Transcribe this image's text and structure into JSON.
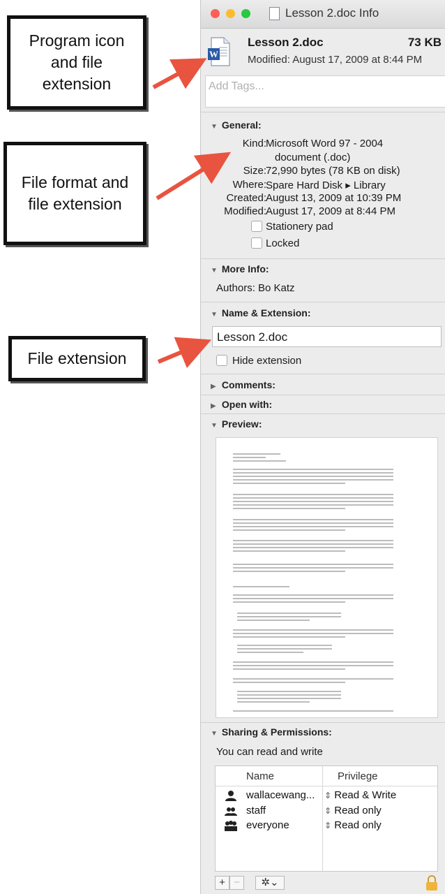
{
  "callouts": {
    "program_icon": "Program icon and file extension",
    "file_format": "File format and file extension",
    "file_extension": "File extension"
  },
  "window": {
    "title": "Lesson 2.doc Info",
    "traffic_lights": {
      "close": "#fc5f57",
      "minimize": "#fdbc2e",
      "zoom": "#28c840"
    }
  },
  "header": {
    "file_name": "Lesson 2.doc",
    "file_size": "73 KB",
    "modified": "Modified: August 17, 2009 at 8:44 PM"
  },
  "tags": {
    "placeholder": "Add Tags..."
  },
  "general": {
    "heading": "General:",
    "kind_label": "Kind:",
    "kind_value_1": "Microsoft Word 97 - 2004",
    "kind_value_2": "document (.doc)",
    "size_label": "Size:",
    "size_value": "72,990 bytes (78 KB on disk)",
    "where_label": "Where:",
    "where_value": "Spare Hard Disk ▸ Library",
    "created_label": "Created:",
    "created_value": "August 13, 2009 at 10:39 PM",
    "modified_label": "Modified:",
    "modified_value": "August 17, 2009 at 8:44 PM",
    "stationery": "Stationery pad",
    "locked": "Locked"
  },
  "more_info": {
    "heading": "More Info:",
    "authors": "Authors: Bo Katz"
  },
  "name_ext": {
    "heading": "Name & Extension:",
    "value": "Lesson 2.doc",
    "hide": "Hide extension"
  },
  "comments": {
    "heading": "Comments:"
  },
  "open_with": {
    "heading": "Open with:"
  },
  "preview": {
    "heading": "Preview:"
  },
  "sharing": {
    "heading": "Sharing & Permissions:",
    "summary": "You can read and write",
    "col_name": "Name",
    "col_privilege": "Privilege",
    "rows": [
      {
        "name": "wallacewang...",
        "privilege": "Read & Write"
      },
      {
        "name": "staff",
        "privilege": "Read only"
      },
      {
        "name": "everyone",
        "privilege": "Read only"
      }
    ]
  },
  "toolbar": {
    "add": "+",
    "remove": "−",
    "action": "✲⌄"
  },
  "icons": {
    "triangle_open": "▼",
    "triangle_closed": "▶",
    "updown": "⇕",
    "lock": "lock-icon"
  }
}
